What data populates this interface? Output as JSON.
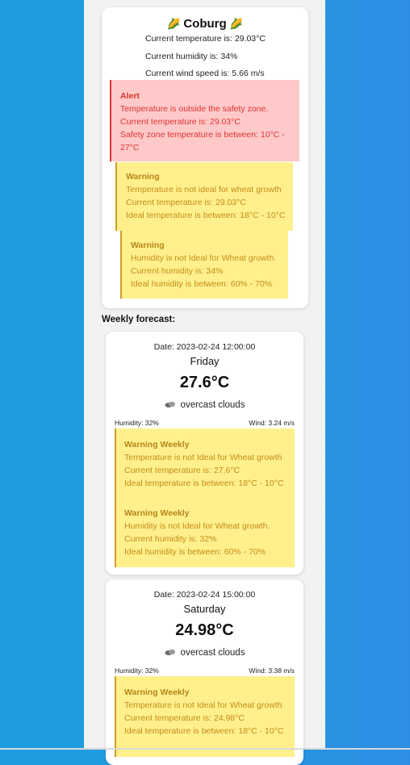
{
  "city": {
    "name": "Coburg",
    "icon": "corn-icon",
    "temperature_line": "Current temperature is: 29.03°C",
    "humidity_line": "Current humidity is: 34%",
    "wind_line": "Current wind speed is: 5.66 m/s"
  },
  "alert": {
    "title": "Alert",
    "line1": "Temperature is outside the safety zone.",
    "line2": "Current temperature is: 29.03°C",
    "line3a": "Safety zone temperature is between: 10°C -",
    "line3b": "27°C"
  },
  "warnings": [
    {
      "title": "Warning",
      "line1": "Temperature is not ideal for wheat growth",
      "line2": "Current temperature is: 29.03°C",
      "line3": "Ideal temperature is between: 18°C - 10°C"
    },
    {
      "title": "Warning",
      "line1": "Humidity is not Ideal for Wheat growth.",
      "line2": "Current humidity is: 34%",
      "line3": "Ideal humidity is between: 60% - 70%"
    }
  ],
  "weekly_label": "Weekly forecast:",
  "forecast": [
    {
      "date": "Date: 2023-02-24 12:00:00",
      "day": "Friday",
      "temp": "27.6°C",
      "icon": "cloud-icon",
      "desc": "overcast clouds",
      "humidity": "Humidity: 32%",
      "wind": "Wind: 3.24 m/s",
      "warnings": [
        {
          "title": "Warning Weekly",
          "line1": "Temperature is not Ideal for Wheat growth",
          "line2": "Current temperature is: 27.6°C",
          "line3": "Ideal temperature is between: 18°C - 10°C"
        },
        {
          "title": "Warning Weekly",
          "line1": "Humidity is not Ideal for Wheat growth.",
          "line2": "Current humidity is: 32%",
          "line3": "Ideal humidity is between: 60% - 70%"
        }
      ]
    },
    {
      "date": "Date: 2023-02-24 15:00:00",
      "day": "Saturday",
      "temp": "24.98°C",
      "icon": "cloud-icon",
      "desc": "overcast clouds",
      "humidity": "Humidity: 32%",
      "wind": "Wind: 3.38 m/s",
      "warnings": [
        {
          "title": "Warning Weekly",
          "line1": "Temperature is not Ideal for Wheat growth",
          "line2": "Current temperature is: 24.98°C",
          "line3": "Ideal temperature is between: 18°C - 10°C"
        }
      ]
    }
  ],
  "colors": {
    "background": "#1f9ce0",
    "alert_bg": "#ffc9c9",
    "alert_text": "#dd3333",
    "warning_bg": "#fff08c",
    "warning_text": "#c48b1a"
  }
}
